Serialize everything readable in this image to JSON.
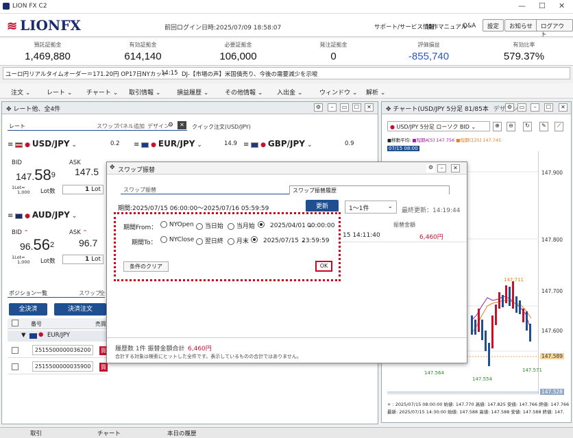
{
  "window": {
    "title": "LION FX C2"
  },
  "header": {
    "logo": "LIONFX",
    "last_login": "前回ログイン日時:2025/07/09 18:58:07",
    "links": [
      "サポート/サービス情報",
      "操作マニュアル",
      "Q&A"
    ],
    "buttons": [
      "設定",
      "お知らせ",
      "ログアウト"
    ]
  },
  "summary": [
    {
      "label": "預託証拠金",
      "value": "1,469,880"
    },
    {
      "label": "有効証拠金",
      "value": "614,140"
    },
    {
      "label": "必要証拠金",
      "value": "106,000"
    },
    {
      "label": "発注証拠金",
      "value": "0"
    },
    {
      "label": "評価損益",
      "value": "-855,740"
    },
    {
      "label": "有効比率",
      "value": "579.37%"
    }
  ],
  "ticker": {
    "left": "ユーロ円リアルタイムオーダー＝171.20円 OP17日NYカット",
    "time": "14:15",
    "news": "DJ-【市場の声】米国債売り、今後の需要減少を示唆"
  },
  "menu": [
    "注文",
    "レート",
    "チャート",
    "取引情報",
    "損益履歴",
    "その他情報",
    "入出金",
    "ウィンドウ",
    "解析"
  ],
  "rate_panel": {
    "title": "レート他、全4件",
    "tabs": {
      "rate": "レート",
      "swap": "スワップ",
      "add": "パネル追加",
      "design": "デザイン",
      "quick": "クイック注文(USD/JPY)"
    },
    "pairs": [
      {
        "name": "USD/JPY",
        "spread": "0.2"
      },
      {
        "name": "EUR/JPY",
        "spread": "14.9"
      },
      {
        "name": "GBP/JPY",
        "spread": "0.9"
      },
      {
        "name": "AUD/JPY"
      }
    ],
    "usdjpy": {
      "bid_label": "BID",
      "ask_label": "ASK",
      "bid_main": "147.",
      "bid_big": "58",
      "bid_small": "9",
      "ask_main": "147.5",
      "lot_label": "Lot数",
      "lot_value": "1",
      "lot_unit": "Lot",
      "per_lot": "1Lot=",
      "per_lot_val": "1,000"
    },
    "audjpy": {
      "bid_label": "BID",
      "ask_label": "ASK",
      "bid_main": "96.",
      "bid_big": "56",
      "bid_small": "2",
      "ask_main": "96.7",
      "lot_label": "Lot数",
      "lot_value": "1",
      "lot_unit": "Lot",
      "per_lot": "1Lot=",
      "per_lot_val": "1,000"
    }
  },
  "positions": {
    "tab": "ポジション一覧",
    "tab2": "スワップ",
    "tab3": "全",
    "btn_close_all": "全決済",
    "btn_settle": "決済注文",
    "col_no": "番号",
    "col_side": "売買",
    "group": "EUR/JPY",
    "rows": [
      {
        "no": "2515500000036200",
        "side": "買"
      },
      {
        "no": "2515500000035900",
        "side": "買"
      }
    ]
  },
  "dialog": {
    "title": "スワップ振替",
    "tab1": "スワップ振替",
    "tab2": "スワップ振替履歴",
    "period": "期間:2025/07/15 06:00:00～2025/07/16 05:59:59",
    "update_btn": "更新",
    "page_select": "1～1件",
    "last_update": "最終更新：14:19:44",
    "from_label": "期間From：",
    "from_opts": [
      "NYOpen",
      "当日始",
      "当月始"
    ],
    "from_date": "2025/04/01",
    "from_time": "00:00:00",
    "to_label": "期間To：",
    "to_opts": [
      "NYClose",
      "翌日終",
      "月末"
    ],
    "to_date": "2025/07/15",
    "to_time": "23:59:59",
    "clear_btn": "条件のクリア",
    "ok_btn": "OK",
    "col_amount": "振替金額",
    "row_time": "15 14:11:40",
    "row_amount": "6,460円",
    "footer_count": "履歴数 1件  振替金額合計",
    "footer_total": "6,460円",
    "footer_note": "合計する対象は検索にヒットした全件です。表示しているものの合計ではありません。"
  },
  "chart_panel": {
    "title": "チャート(USD/JPY 5分足 81/85本",
    "design": "デザイン",
    "symbol": "USD/JPY 5分足 ローソク BID",
    "legend": {
      "ma_label": "■移動平均:",
      "ma5": "■短期A[5] 147.756",
      "ma25": "■短期C[25] 147.745"
    },
    "date_tag": "07/15 08:00",
    "y_ticks": [
      "147.900",
      "147.800",
      "147.700",
      "147.600",
      "147.528"
    ],
    "current_price": "147.589",
    "markers": [
      "147.711",
      "147.564",
      "147.554",
      "147.571"
    ],
    "info_line1": "+ : 2025/07/15 08:00:00 始値: 147.770 高値: 147.825 安値: 147.766 終値: 147.766 ",
    "info_line2": "最新: 2025/07/15 14:30:00 始値: 147.588 高値: 147.588 安値: 147.588 終値: 147.",
    "accent_red": "#c8102e",
    "accent_blue": "#1f4e91"
  },
  "statusbar": [
    "取引",
    "チャート",
    "本日の履歴"
  ]
}
